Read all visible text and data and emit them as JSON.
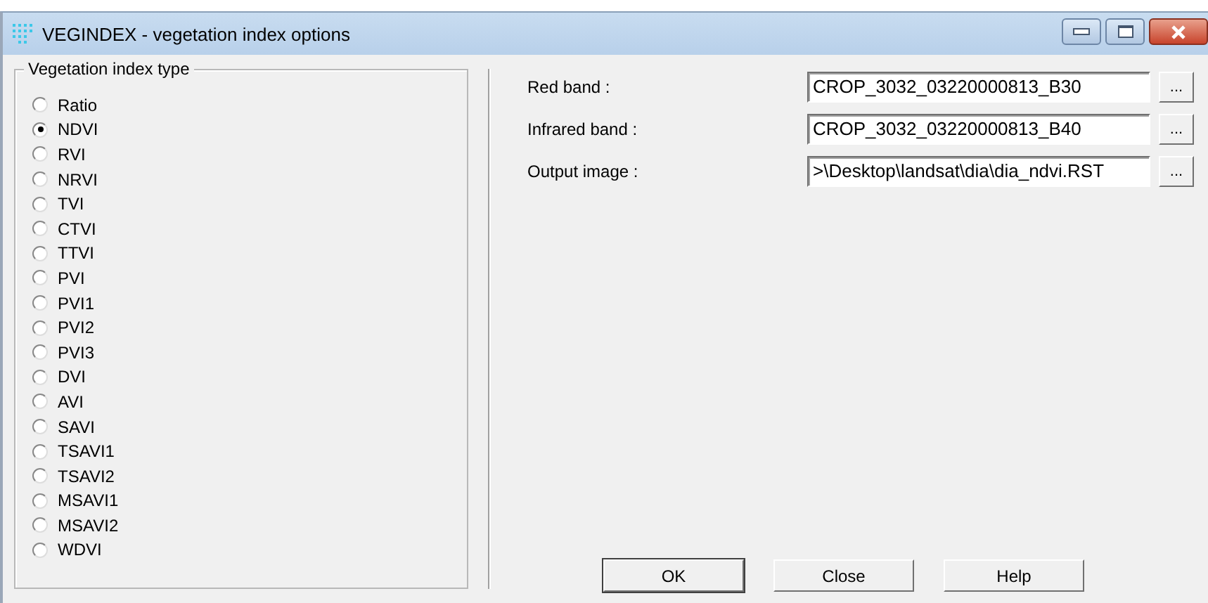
{
  "window": {
    "title": "VEGINDEX - vegetation index options"
  },
  "index_type": {
    "legend": "Vegetation index type",
    "options": [
      {
        "label": "Ratio",
        "selected": false
      },
      {
        "label": "NDVI",
        "selected": true
      },
      {
        "label": "RVI",
        "selected": false
      },
      {
        "label": "NRVI",
        "selected": false
      },
      {
        "label": "TVI",
        "selected": false
      },
      {
        "label": "CTVI",
        "selected": false
      },
      {
        "label": "TTVI",
        "selected": false
      },
      {
        "label": "PVI",
        "selected": false
      },
      {
        "label": "PVI1",
        "selected": false
      },
      {
        "label": "PVI2",
        "selected": false
      },
      {
        "label": "PVI3",
        "selected": false
      },
      {
        "label": "DVI",
        "selected": false
      },
      {
        "label": "AVI",
        "selected": false
      },
      {
        "label": "SAVI",
        "selected": false
      },
      {
        "label": "TSAVI1",
        "selected": false
      },
      {
        "label": "TSAVI2",
        "selected": false
      },
      {
        "label": "MSAVI1",
        "selected": false
      },
      {
        "label": "MSAVI2",
        "selected": false
      },
      {
        "label": "WDVI",
        "selected": false
      }
    ]
  },
  "fields": [
    {
      "label": "Red band :",
      "value": "CROP_3032_03220000813_B30",
      "browse": "..."
    },
    {
      "label": "Infrared band :",
      "value": "CROP_3032_03220000813_B40",
      "browse": "..."
    },
    {
      "label": "Output image :",
      "value": ">\\Desktop\\landsat\\dia\\dia_ndvi.RST",
      "browse": "..."
    }
  ],
  "buttons": [
    "OK",
    "Close",
    "Help"
  ]
}
